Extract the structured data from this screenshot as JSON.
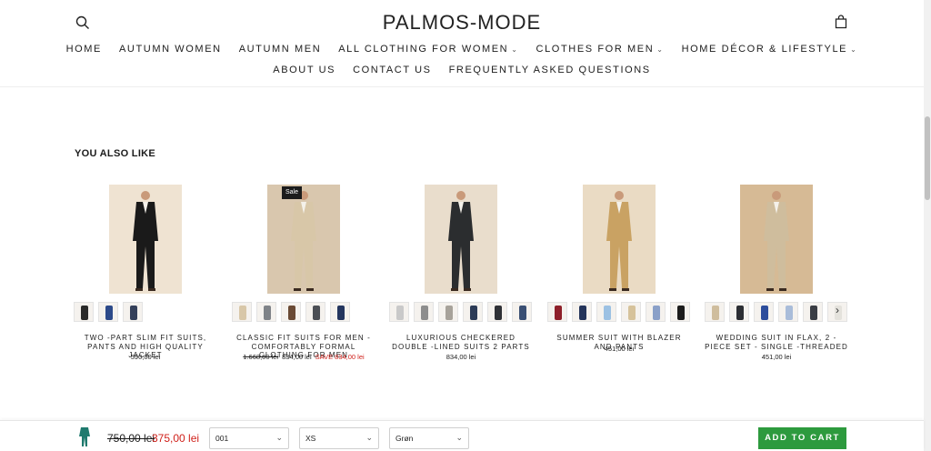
{
  "store": {
    "logo": "PALMOS-MODE"
  },
  "nav": {
    "row1": [
      {
        "label": "HOME",
        "dropdown": false
      },
      {
        "label": "AUTUMN WOMEN",
        "dropdown": false
      },
      {
        "label": "AUTUMN MEN",
        "dropdown": false
      },
      {
        "label": "ALL CLOTHING FOR WOMEN",
        "dropdown": true
      },
      {
        "label": "CLOTHES FOR MEN",
        "dropdown": true
      },
      {
        "label": "HOME DÉCOR & LIFESTYLE",
        "dropdown": true
      }
    ],
    "row2": [
      {
        "label": "ABOUT US"
      },
      {
        "label": "CONTACT US"
      },
      {
        "label": "FREQUENTLY ASKED QUESTIONS"
      }
    ],
    "chevron": "⌄"
  },
  "recommendations": {
    "title": "YOU ALSO LIKE",
    "sale_badge": "Sale",
    "products": [
      {
        "title": "TWO -PART SLIM FIT SUITS, PANTS AND HIGH QUALITY JACKET",
        "price": "590,00 lei",
        "suit_color": "#1a1a1a",
        "bg": "#efe3d2",
        "swatches": [
          "#2a2a2a",
          "#2c4a8a",
          "#34405a"
        ]
      },
      {
        "title": "CLASSIC FIT SUITS FOR MEN - COMFORTABLY FORMAL CLOTHING FOR MEN",
        "old_price": "1.668,00 lei",
        "price": "834,00 lei",
        "save": "SAVE 834,00 lei",
        "suit_color": "#d8c7a8",
        "bg": "#d9c7ae",
        "swatches": [
          "#d8c7a8",
          "#7f8388",
          "#6a4a34",
          "#4c4f55",
          "#24365f"
        ]
      },
      {
        "title": "LUXURIOUS CHECKERED DOUBLE -LINED SUITS 2 PARTS",
        "price": "834,00 lei",
        "suit_color": "#2b2d2f",
        "bg": "#e9ddcc",
        "swatches": [
          "#c9c9c9",
          "#8d8d8d",
          "#a7a29a",
          "#2c3b56",
          "#2f3136",
          "#3a4f73"
        ]
      },
      {
        "title": "SUMMER SUIT WITH BLAZER AND PANTS",
        "price": "451,00 lei",
        "suit_color": "#c9a263",
        "bg": "#eadbc4",
        "swatches": [
          "#8e1f2a",
          "#24345a",
          "#9cc1e3",
          "#d6c29a",
          "#8aa0c8",
          "#1c1c1c"
        ]
      },
      {
        "title": "WEDDING SUIT IN FLAX, 2 -PIECE SET - SINGLE -THREADED",
        "price": "451,00 lei",
        "suit_color": "#cfbd9d",
        "bg": "#d6ba95",
        "swatches": [
          "#cfbd9d",
          "#2c2e33",
          "#2d4d9c",
          "#a9bcd9",
          "#3a3d44",
          "#e4e2dc"
        ]
      }
    ]
  },
  "sticky_bar": {
    "old_price": "750,00 lei",
    "new_price": "375,00 lei",
    "variant_select": "001",
    "size_select": "XS",
    "color_select": "Grøn",
    "add_to_cart": "ADD TO CART",
    "thumb_color": "#1f7a6e"
  },
  "colors": {
    "accent_green": "#2d9a3e",
    "sale_red": "#d0211b"
  }
}
